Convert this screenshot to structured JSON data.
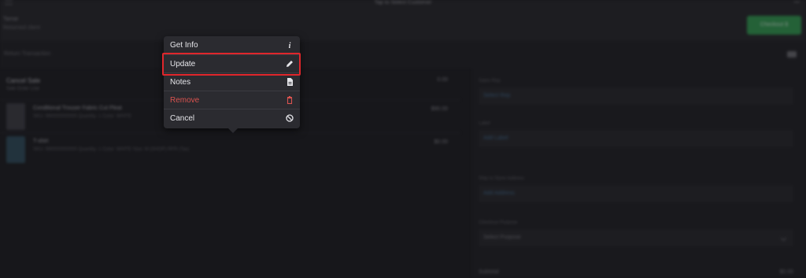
{
  "topbar": {
    "title": "Tap to Select Customer",
    "customer_label": "Tamar",
    "customer_sub": "Returned client",
    "checkout_label": "Checkout $"
  },
  "subbar": {
    "back_label": "Return Transaction"
  },
  "list": {
    "section_title": "Cancel Sale",
    "section_sub": "Sale Order Line",
    "section_amount": "0.00",
    "items": [
      {
        "name": "Conditional Trouser Fabric Cut Pleat",
        "desc": "SKU: 990000000000 Quantity: 1 Color: WHITE",
        "price": "$90.00"
      },
      {
        "name": "T-shirt",
        "desc": "SKU: 990000000000 Quantity: 1 Color: WHITE Size: M (SHOP) RFR (Tax)",
        "price": "$0.00"
      }
    ]
  },
  "panel": {
    "fields": [
      {
        "label": "Sales Rep",
        "value": "Select Rep"
      },
      {
        "label": "Label",
        "value": "Add Label"
      },
      {
        "label": "Ship to Store Address",
        "value": "Add Address"
      },
      {
        "label": "Checkout Purpose",
        "value": "Select Purpose"
      }
    ],
    "subtotal_label": "Subtotal",
    "subtotal_amount": "$0.00"
  },
  "popover": {
    "items": [
      {
        "label": "Get Info",
        "icon": "info-icon"
      },
      {
        "label": "Update",
        "icon": "pencil-icon"
      },
      {
        "label": "Notes",
        "icon": "document-icon"
      },
      {
        "label": "Remove",
        "icon": "trash-icon",
        "color": "#d9534f"
      },
      {
        "label": "Cancel",
        "icon": "cancel-icon"
      }
    ],
    "highlight_color": "#e0262b"
  },
  "colors": {
    "accent_green": "#2f9e4f",
    "danger": "#d9534f",
    "background": "#17171b"
  }
}
